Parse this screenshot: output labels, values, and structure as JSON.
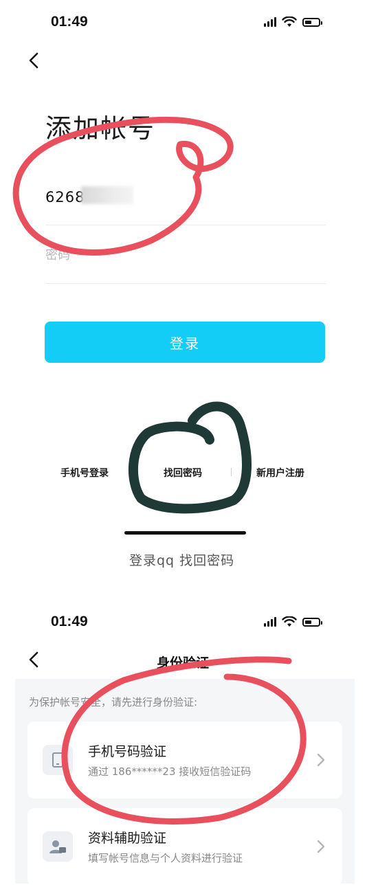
{
  "screen1": {
    "status_time": "01:49",
    "title": "添加帐号",
    "account_value": "6268",
    "password_placeholder": "密码",
    "login_label": "登录",
    "links": {
      "phone_login": "手机号登录",
      "find_password": "找回密码",
      "register": "新用户注册"
    },
    "caption": "登录qq 找回密码"
  },
  "screen2": {
    "status_time": "01:49",
    "nav_title": "身份验证",
    "hint": "为保护帐号安全，请先进行身份验证:",
    "options": [
      {
        "title": "手机号码验证",
        "subtitle": "通过 186******23 接收短信验证码"
      },
      {
        "title": "资料辅助验证",
        "subtitle": "填写帐号信息与个人资料进行验证"
      }
    ]
  },
  "colors": {
    "accent": "#13cdf6",
    "red_annotation": "#e8505e",
    "dark_annotation": "#1f3a36"
  },
  "icons": [
    "back-icon",
    "signal-icon",
    "wifi-icon",
    "battery-icon",
    "phone-icon",
    "id-card-icon",
    "chevron-right-icon"
  ]
}
